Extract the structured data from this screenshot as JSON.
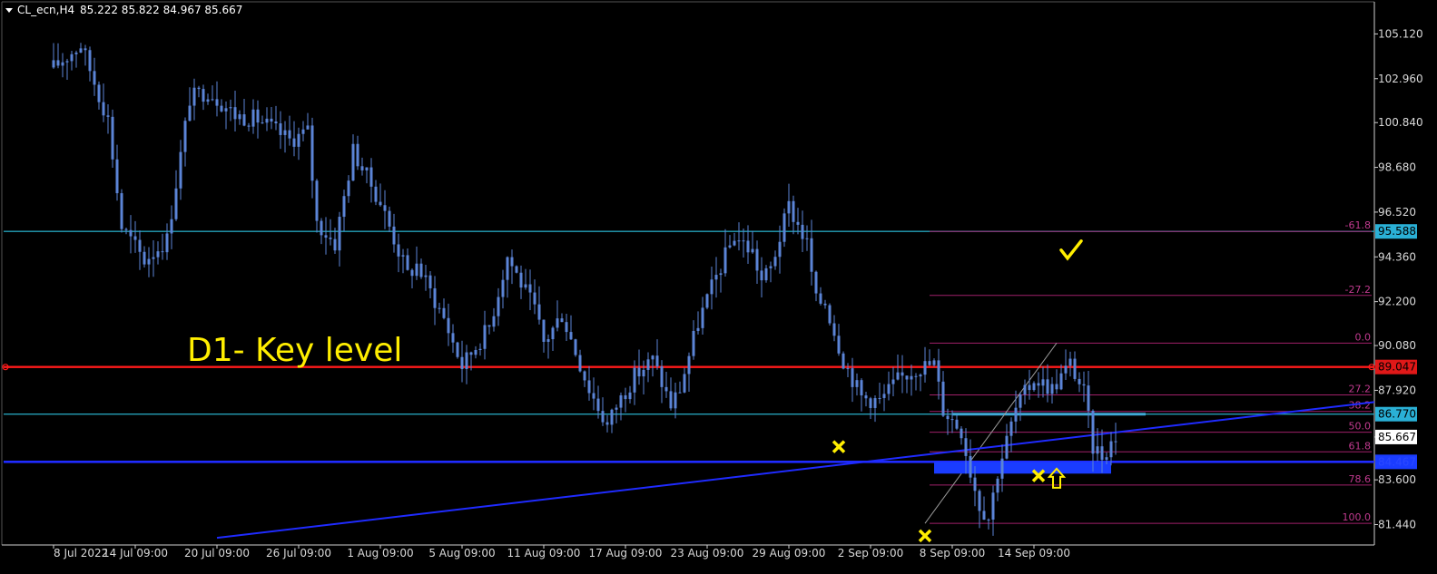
{
  "header": {
    "symbol_label": "CL_ecn,H4",
    "ohlc": "85.222 85.822 84.967 85.667"
  },
  "annotation_text": "D1- Key level",
  "colors": {
    "background": "#000000",
    "candle": "#5b84d6",
    "key_level": "#ff1a1a",
    "support_line": "#1f2bff",
    "horizontal_cyan": "#24a0b8",
    "fib": "#a0206a",
    "fib_label": "#c03a8e",
    "marker": "#ffee00",
    "axis_text": "#d8d8d8",
    "badge_cyan": "#2ab0d6",
    "badge_red": "#e01818",
    "badge_blue": "#1a3cff",
    "badge_white": "#ffffff"
  },
  "chart_data": {
    "type": "candlestick",
    "title": "CL_ecn,H4",
    "ylim": [
      80.8,
      106.0
    ],
    "y_ticks": [
      "105.120",
      "102.960",
      "100.840",
      "98.680",
      "96.520",
      "94.360",
      "92.200",
      "90.080",
      "87.920",
      "85.667",
      "83.600",
      "81.440"
    ],
    "x_ticks": [
      "8 Jul 2022",
      "14 Jul 09:00",
      "20 Jul 09:00",
      "26 Jul 09:00",
      "1 Aug 09:00",
      "5 Aug 09:00",
      "11 Aug 09:00",
      "17 Aug 09:00",
      "23 Aug 09:00",
      "29 Aug 09:00",
      "2 Sep 09:00",
      "8 Sep 09:00",
      "14 Sep 09:00"
    ],
    "close_path": [
      [
        0,
        103.5
      ],
      [
        6,
        104.6
      ],
      [
        12,
        101.0
      ],
      [
        15,
        95.8
      ],
      [
        20,
        94.2
      ],
      [
        25,
        95.2
      ],
      [
        30,
        102.0
      ],
      [
        34,
        102.4
      ],
      [
        40,
        101.2
      ],
      [
        45,
        101.0
      ],
      [
        52,
        100.0
      ],
      [
        56,
        100.4
      ],
      [
        58,
        96.0
      ],
      [
        62,
        95.0
      ],
      [
        66,
        99.5
      ],
      [
        72,
        97.0
      ],
      [
        78,
        93.5
      ],
      [
        80,
        94.0
      ],
      [
        86,
        91.4
      ],
      [
        90,
        89.1
      ],
      [
        96,
        91.0
      ],
      [
        100,
        94.4
      ],
      [
        106,
        91.8
      ],
      [
        108,
        90.2
      ],
      [
        112,
        91.6
      ],
      [
        118,
        88.0
      ],
      [
        122,
        86.2
      ],
      [
        124,
        87.2
      ],
      [
        128,
        88.6
      ],
      [
        132,
        89.4
      ],
      [
        136,
        87.2
      ],
      [
        138,
        88.0
      ],
      [
        142,
        91.2
      ],
      [
        146,
        93.4
      ],
      [
        150,
        95.4
      ],
      [
        154,
        94.6
      ],
      [
        156,
        93.2
      ],
      [
        158,
        93.8
      ],
      [
        162,
        96.8
      ],
      [
        166,
        95.0
      ],
      [
        168,
        92.2
      ],
      [
        170,
        92.2
      ],
      [
        174,
        89.4
      ],
      [
        178,
        87.6
      ],
      [
        182,
        87.4
      ],
      [
        186,
        88.4
      ],
      [
        190,
        89.0
      ],
      [
        194,
        89.2
      ],
      [
        196,
        87.0
      ],
      [
        200,
        86.0
      ],
      [
        202,
        84.0
      ],
      [
        204,
        82.4
      ],
      [
        206,
        81.8
      ],
      [
        208,
        84.0
      ],
      [
        212,
        87.0
      ],
      [
        216,
        88.5
      ],
      [
        220,
        88.0
      ],
      [
        224,
        89.2
      ],
      [
        227,
        87.8
      ],
      [
        229,
        85.2
      ],
      [
        231,
        84.8
      ],
      [
        234,
        85.7
      ]
    ],
    "bar_count": 235,
    "date_bars": {
      "8 Jul 2022": 0,
      "14 Jul 09:00": 18,
      "20 Jul 09:00": 36,
      "26 Jul 09:00": 54,
      "1 Aug 09:00": 72,
      "5 Aug 09:00": 90,
      "11 Aug 09:00": 108,
      "17 Aug 09:00": 126,
      "23 Aug 09:00": 144,
      "29 Aug 09:00": 162,
      "2 Sep 09:00": 180,
      "8 Sep 09:00": 198,
      "14 Sep 09:00": 216
    },
    "horizontal_levels": [
      {
        "value": 95.588,
        "badge": "95.588",
        "kind": "cyan"
      },
      {
        "value": 89.047,
        "badge": "89.047",
        "kind": "red"
      },
      {
        "value": 86.77,
        "badge": "86.770",
        "kind": "cyan"
      },
      {
        "value": 84.467,
        "badge": "84.467",
        "kind": "blue"
      }
    ],
    "last_price": {
      "value": 85.667,
      "badge": "85.667"
    },
    "trend_line": {
      "from_bar": 36,
      "from_value": 80.8,
      "to_bar": 250,
      "to_value": 86.3
    },
    "fibonacci": {
      "start_bar": 193,
      "end_bar": 250,
      "levels": [
        {
          "label": "-61.8",
          "value": 95.588
        },
        {
          "label": "-27.2",
          "value": 92.5
        },
        {
          "label": "0.0",
          "value": 90.2
        },
        {
          "label": "27.2",
          "value": 87.7
        },
        {
          "label": "38.2",
          "value": 86.9
        },
        {
          "label": "50.0",
          "value": 85.9
        },
        {
          "label": "61.8",
          "value": 84.95
        },
        {
          "label": "78.6",
          "value": 83.35
        },
        {
          "label": "100.0",
          "value": 81.5
        }
      ]
    },
    "support_zone": {
      "from_bar": 194,
      "to_bar": 233,
      "low": 83.9,
      "high": 84.467
    },
    "markers": [
      {
        "type": "cross",
        "bar": 173,
        "value": 85.2
      },
      {
        "type": "cross",
        "bar": 192,
        "value": 80.9
      },
      {
        "type": "cross",
        "bar": 217,
        "value": 83.8
      },
      {
        "type": "arrow-up",
        "bar": 221,
        "value": 83.7
      },
      {
        "type": "check",
        "bar": 224,
        "value": 94.6
      }
    ]
  }
}
